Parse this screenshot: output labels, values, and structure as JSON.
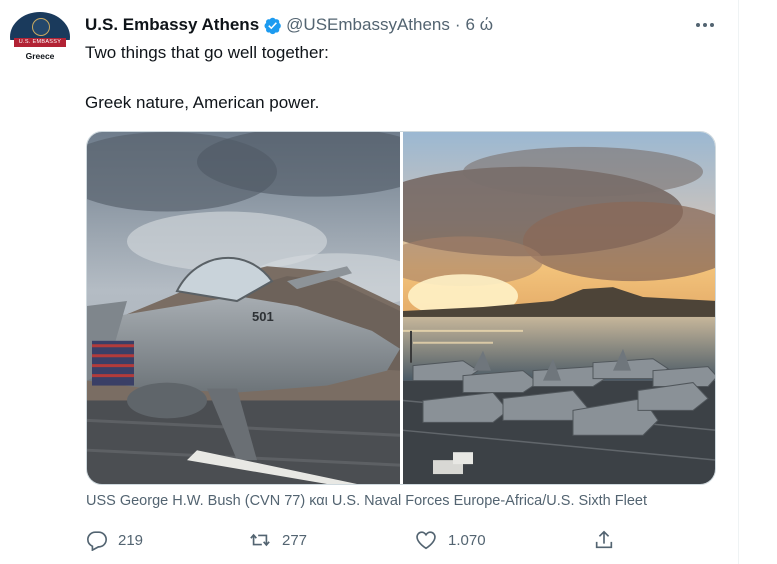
{
  "tweet": {
    "author_name": "U.S. Embassy Athens",
    "handle": "@USEmbassyAthens",
    "separator": "·",
    "time": "6 ώ",
    "text_line1": "Two things that go well together:",
    "text_line2": "Greek nature, American power.",
    "caption": "USS George H.W. Bush (CVN 77) και U.S. Naval Forces Europe-Africa/U.S. Sixth Fleet"
  },
  "avatar": {
    "ribbon": "U.S. EMBASSY",
    "country": "Greece"
  },
  "aircraft_marking": "501",
  "actions": {
    "replies": "219",
    "retweets": "277",
    "likes": "1.070"
  },
  "icons": {
    "verified": "verified-badge-icon",
    "more": "more-options-icon",
    "reply": "reply-icon",
    "retweet": "retweet-icon",
    "like": "heart-icon",
    "share": "share-icon"
  },
  "colors": {
    "verified": "#1d9bf0",
    "secondary_text": "#536471",
    "primary_text": "#0f1419"
  }
}
